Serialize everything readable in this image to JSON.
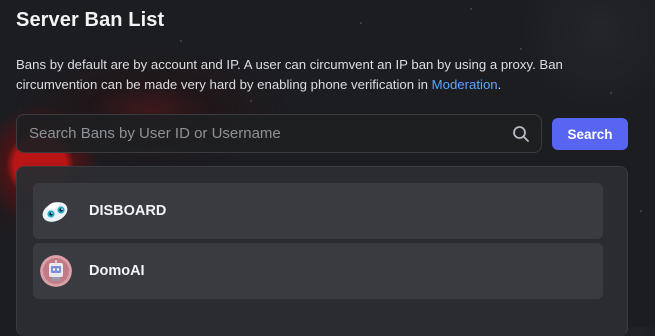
{
  "header": {
    "title": "Server Ban List"
  },
  "description": {
    "text": "Bans by default are by account and IP. A user can circumvent an IP ban by using a proxy. Ban circumvention can be made very hard by enabling phone verification in ",
    "link_label": "Moderation",
    "suffix": "."
  },
  "search": {
    "placeholder": "Search Bans by User ID or Username",
    "value": "",
    "button_label": "Search",
    "icon": "search-icon"
  },
  "bans": [
    {
      "name": "DISBOARD",
      "avatar_icon": "disboard-avatar"
    },
    {
      "name": "DomoAI",
      "avatar_icon": "domoai-avatar"
    }
  ],
  "colors": {
    "accent": "#5865f2",
    "link": "#58a6ff",
    "row_bg": "#393b41",
    "panel_bg": "#2b2d31"
  }
}
